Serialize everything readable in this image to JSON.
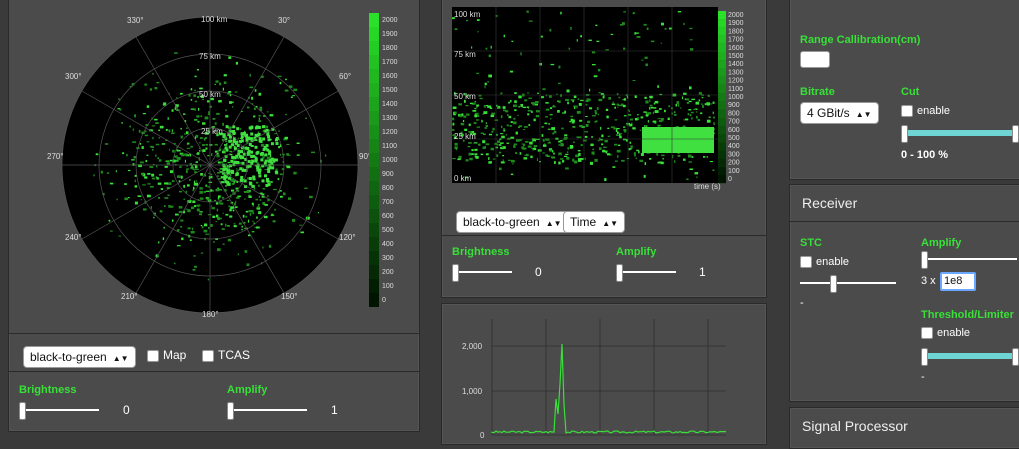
{
  "ppi": {
    "range_labels": [
      "100 km",
      "75 km",
      "50 km",
      "25 km"
    ],
    "bearing_labels": [
      "330°",
      "30°",
      "300°",
      "60°",
      "270°",
      "90°",
      "240°",
      "120°",
      "210°",
      "150°",
      "180°"
    ],
    "colorbar_labels": [
      "2000",
      "1900",
      "1800",
      "1700",
      "1600",
      "1500",
      "1400",
      "1300",
      "1200",
      "1100",
      "1000",
      "900",
      "800",
      "700",
      "600",
      "500",
      "400",
      "300",
      "200",
      "100",
      "0"
    ],
    "colormap_select": "black-to-green",
    "map_label": "Map",
    "tcas_label": "TCAS",
    "brightness_label": "Brightness",
    "brightness_value": "0",
    "amplify_label": "Amplify",
    "amplify_value": "1"
  },
  "waterfall": {
    "range_labels": [
      "100 km",
      "75 km",
      "50 km",
      "25 km",
      "0 km"
    ],
    "time_axis_label": "time (s)",
    "colorbar_labels": [
      "2000",
      "1900",
      "1800",
      "1700",
      "1600",
      "1500",
      "1400",
      "1300",
      "1200",
      "1100",
      "1000",
      "900",
      "800",
      "700",
      "600",
      "500",
      "400",
      "300",
      "200",
      "100",
      "0"
    ],
    "colormap_select": "black-to-green",
    "mode_select": "Time",
    "brightness_label": "Brightness",
    "brightness_value": "0",
    "amplify_label": "Amplify",
    "amplify_value": "1"
  },
  "ascope": {
    "y_labels": [
      "2,000",
      "1,000",
      "0"
    ]
  },
  "calibration": {
    "range_cal_label": "Range Callibration(cm)",
    "range_cal_value": "",
    "bitrate_label": "Bitrate",
    "bitrate_select": "4 GBit/s",
    "cut_label": "Cut",
    "cut_enable_label": "enable",
    "cut_range_text": "0 - 100 %"
  },
  "receiver": {
    "title": "Receiver",
    "stc_label": "STC",
    "stc_enable_label": "enable",
    "stc_value": "-",
    "amplify_label": "Amplify",
    "amplify_prefix": "3 x",
    "amplify_value": "1e8",
    "threshold_label": "Threshold/Limiter",
    "threshold_enable_label": "enable",
    "threshold_value": "-"
  },
  "signal_processor": {
    "title": "Signal Processor"
  },
  "colors": {
    "accent_green": "#38e038",
    "panel_bg": "#4b4b4b",
    "slider_fill": "#6fd4d4"
  }
}
